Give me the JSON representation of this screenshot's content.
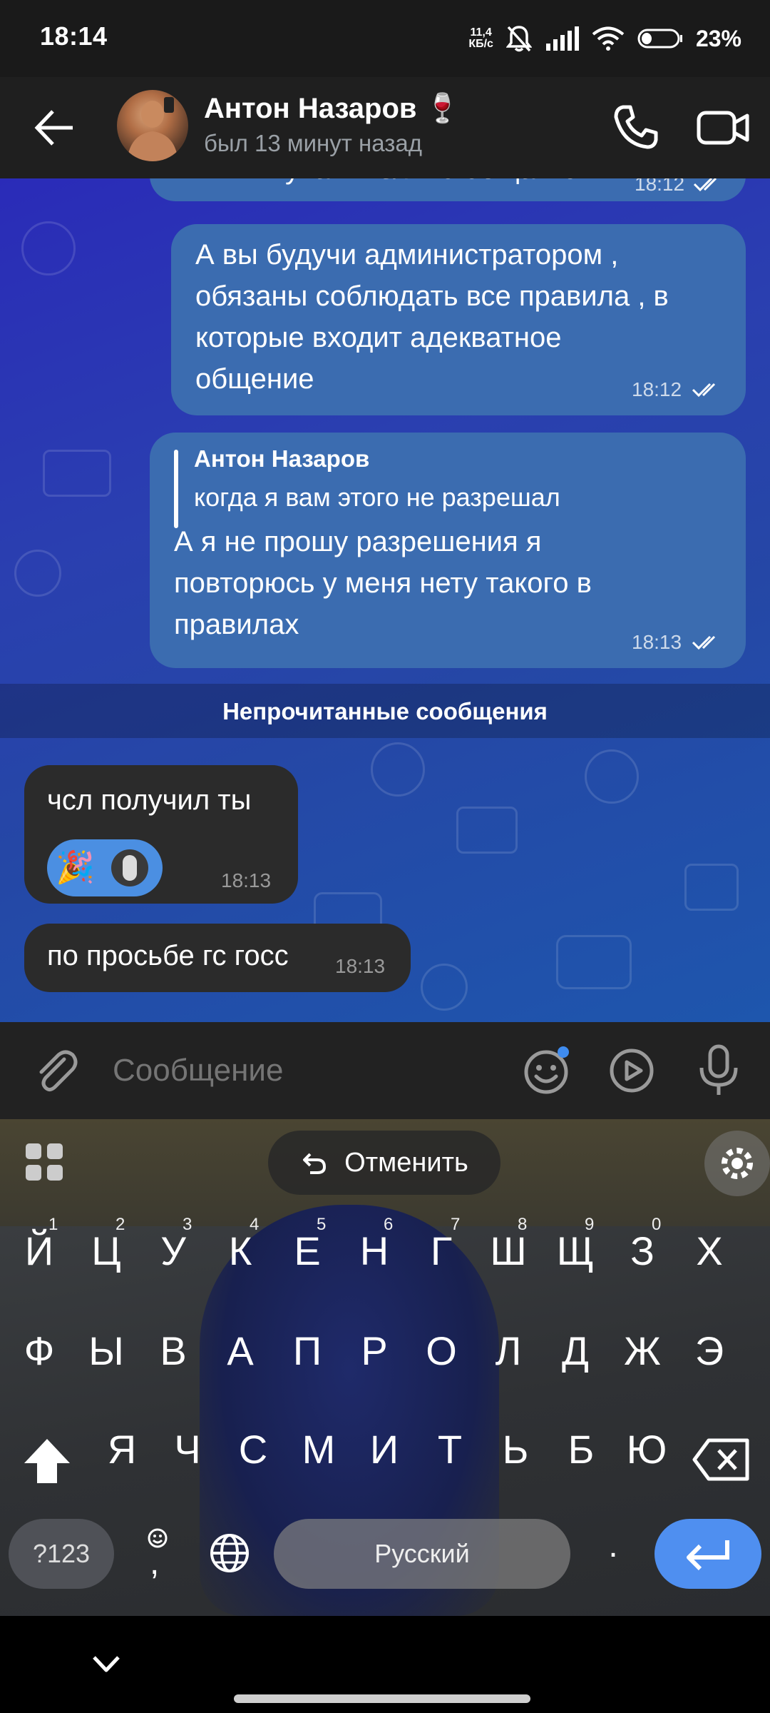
{
  "status_bar": {
    "time": "18:14",
    "net_speed_value": "11,4",
    "net_speed_unit": "КБ/с",
    "battery": "23%"
  },
  "header": {
    "contact_name": "Антон Назаров 🍷",
    "contact_status": "был 13 минут назад"
  },
  "messages": {
    "partial": {
      "text": "уважительно общаться",
      "time": "18:12"
    },
    "out1": {
      "lines": [
        "А вы будучи администратором ,",
        "обязаны соблюдать все правила , в",
        "которые входит адекватное",
        "общение"
      ],
      "time": "18:12"
    },
    "out2": {
      "reply_author": "Антон Назаров",
      "reply_text": "когда я вам этого не разрешал",
      "lines": [
        "А я не прошу разрешения я",
        "повторюсь у меня нету такого в",
        "правилах"
      ],
      "time": "18:13"
    },
    "unread_label": "Непрочитанные сообщения",
    "in1": {
      "text": "чсл получил ты",
      "reaction_emoji": "🎉",
      "time": "18:13"
    },
    "in2": {
      "text": "по просьбе гс госс",
      "time": "18:13"
    }
  },
  "input": {
    "placeholder": "Сообщение"
  },
  "keyboard": {
    "undo_label": "Отменить",
    "row1": [
      "Й",
      "Ц",
      "У",
      "К",
      "Е",
      "Н",
      "Г",
      "Ш",
      "Щ",
      "З",
      "Х"
    ],
    "row1_hints": [
      "1",
      "2",
      "3",
      "4",
      "5",
      "6",
      "7",
      "8",
      "9",
      "0"
    ],
    "row2": [
      "Ф",
      "Ы",
      "В",
      "А",
      "П",
      "Р",
      "О",
      "Л",
      "Д",
      "Ж",
      "Э"
    ],
    "row3": [
      "Я",
      "Ч",
      "С",
      "М",
      "И",
      "Т",
      "Ь",
      "Б",
      "Ю"
    ],
    "num_label": "?123",
    "comma": ",",
    "space_label": "Русский",
    "period": "."
  },
  "colors": {
    "outgoing_bubble": "#3b6cb0",
    "incoming_bubble": "#2b2b2b",
    "chat_bg": "#2a3fb0",
    "enter_key": "#4f8ff0"
  }
}
